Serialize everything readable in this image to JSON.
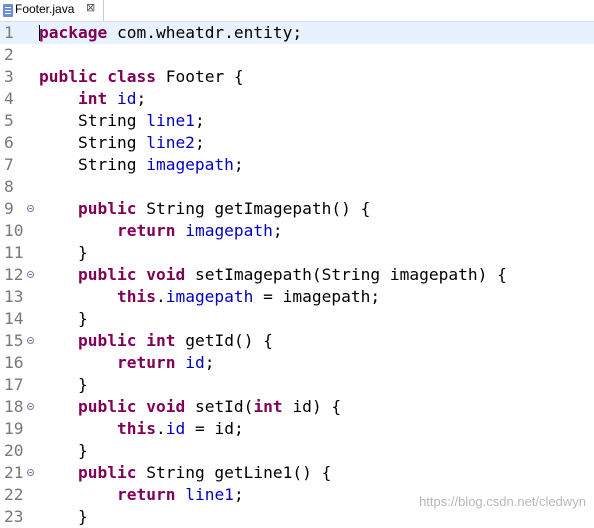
{
  "tab": {
    "label": "Footer.java",
    "close_glyph": "⊠",
    "icon": "java-file-icon"
  },
  "colors": {
    "keyword": "#7f0055",
    "field": "#0000c0",
    "text": "#000000",
    "line_number": "#787878",
    "current_line": "#e8f2fe"
  },
  "lines": [
    {
      "n": "1",
      "fold": false,
      "current": true,
      "tokens": [
        [
          "kw",
          "package"
        ],
        [
          "t",
          " com.wheatdr.entity;"
        ]
      ]
    },
    {
      "n": "2",
      "fold": false,
      "tokens": []
    },
    {
      "n": "3",
      "fold": false,
      "tokens": [
        [
          "kw",
          "public"
        ],
        [
          "t",
          " "
        ],
        [
          "kw",
          "class"
        ],
        [
          "t",
          " Footer {"
        ]
      ]
    },
    {
      "n": "4",
      "fold": false,
      "tokens": [
        [
          "t",
          "    "
        ],
        [
          "kw",
          "int"
        ],
        [
          "t",
          " "
        ],
        [
          "f",
          "id"
        ],
        [
          "t",
          ";"
        ]
      ]
    },
    {
      "n": "5",
      "fold": false,
      "tokens": [
        [
          "t",
          "    String "
        ],
        [
          "f",
          "line1"
        ],
        [
          "t",
          ";"
        ]
      ]
    },
    {
      "n": "6",
      "fold": false,
      "tokens": [
        [
          "t",
          "    String "
        ],
        [
          "f",
          "line2"
        ],
        [
          "t",
          ";"
        ]
      ]
    },
    {
      "n": "7",
      "fold": false,
      "tokens": [
        [
          "t",
          "    String "
        ],
        [
          "f",
          "imagepath"
        ],
        [
          "t",
          ";"
        ]
      ]
    },
    {
      "n": "8",
      "fold": false,
      "tokens": []
    },
    {
      "n": "9",
      "fold": true,
      "tokens": [
        [
          "t",
          "    "
        ],
        [
          "kw",
          "public"
        ],
        [
          "t",
          " String getImagepath() {"
        ]
      ]
    },
    {
      "n": "10",
      "fold": false,
      "tokens": [
        [
          "t",
          "        "
        ],
        [
          "kw",
          "return"
        ],
        [
          "t",
          " "
        ],
        [
          "f",
          "imagepath"
        ],
        [
          "t",
          ";"
        ]
      ]
    },
    {
      "n": "11",
      "fold": false,
      "tokens": [
        [
          "t",
          "    }"
        ]
      ]
    },
    {
      "n": "12",
      "fold": true,
      "tokens": [
        [
          "t",
          "    "
        ],
        [
          "kw",
          "public"
        ],
        [
          "t",
          " "
        ],
        [
          "kw",
          "void"
        ],
        [
          "t",
          " setImagepath(String "
        ],
        [
          "p",
          "imagepath"
        ],
        [
          "t",
          ") {"
        ]
      ]
    },
    {
      "n": "13",
      "fold": false,
      "tokens": [
        [
          "t",
          "        "
        ],
        [
          "kw",
          "this"
        ],
        [
          "t",
          "."
        ],
        [
          "f",
          "imagepath"
        ],
        [
          "t",
          " = "
        ],
        [
          "p",
          "imagepath"
        ],
        [
          "t",
          ";"
        ]
      ]
    },
    {
      "n": "14",
      "fold": false,
      "tokens": [
        [
          "t",
          "    }"
        ]
      ]
    },
    {
      "n": "15",
      "fold": true,
      "tokens": [
        [
          "t",
          "    "
        ],
        [
          "kw",
          "public"
        ],
        [
          "t",
          " "
        ],
        [
          "kw",
          "int"
        ],
        [
          "t",
          " getId() {"
        ]
      ]
    },
    {
      "n": "16",
      "fold": false,
      "tokens": [
        [
          "t",
          "        "
        ],
        [
          "kw",
          "return"
        ],
        [
          "t",
          " "
        ],
        [
          "f",
          "id"
        ],
        [
          "t",
          ";"
        ]
      ]
    },
    {
      "n": "17",
      "fold": false,
      "tokens": [
        [
          "t",
          "    }"
        ]
      ]
    },
    {
      "n": "18",
      "fold": true,
      "tokens": [
        [
          "t",
          "    "
        ],
        [
          "kw",
          "public"
        ],
        [
          "t",
          " "
        ],
        [
          "kw",
          "void"
        ],
        [
          "t",
          " setId("
        ],
        [
          "kw",
          "int"
        ],
        [
          "t",
          " "
        ],
        [
          "p",
          "id"
        ],
        [
          "t",
          ") {"
        ]
      ]
    },
    {
      "n": "19",
      "fold": false,
      "tokens": [
        [
          "t",
          "        "
        ],
        [
          "kw",
          "this"
        ],
        [
          "t",
          "."
        ],
        [
          "f",
          "id"
        ],
        [
          "t",
          " = "
        ],
        [
          "p",
          "id"
        ],
        [
          "t",
          ";"
        ]
      ]
    },
    {
      "n": "20",
      "fold": false,
      "tokens": [
        [
          "t",
          "    }"
        ]
      ]
    },
    {
      "n": "21",
      "fold": true,
      "tokens": [
        [
          "t",
          "    "
        ],
        [
          "kw",
          "public"
        ],
        [
          "t",
          " String getLine1() {"
        ]
      ]
    },
    {
      "n": "22",
      "fold": false,
      "tokens": [
        [
          "t",
          "        "
        ],
        [
          "kw",
          "return"
        ],
        [
          "t",
          " "
        ],
        [
          "f",
          "line1"
        ],
        [
          "t",
          ";"
        ]
      ]
    },
    {
      "n": "23",
      "fold": false,
      "tokens": [
        [
          "t",
          "    }"
        ]
      ]
    }
  ],
  "watermark": "https://blog.csdn.net/cledwyn"
}
